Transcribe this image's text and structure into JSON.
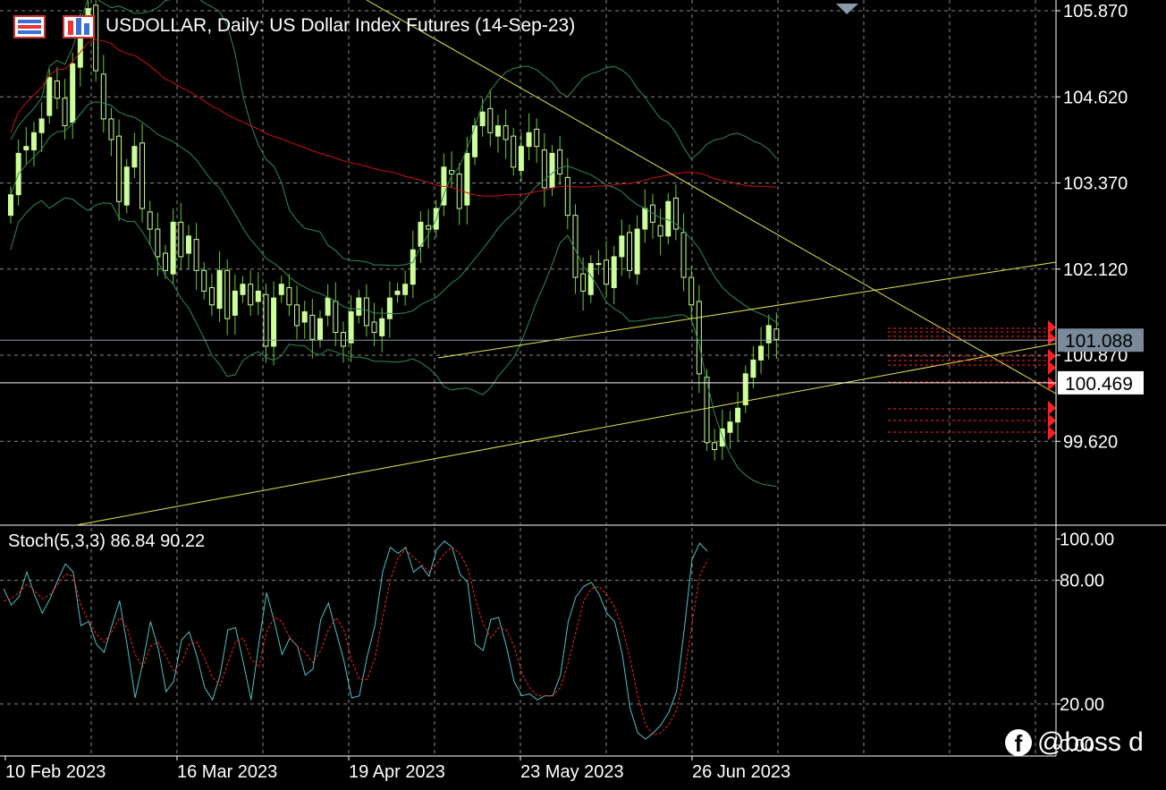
{
  "header": {
    "title": "USDOLLAR, Daily:  US Dollar Index Futures (14-Sep-23)"
  },
  "toolbar": {
    "icons": [
      "bars-chart-icon",
      "candles-chart-icon"
    ]
  },
  "indicator": {
    "label": "Stoch(5,3,3) 86.84 90.22",
    "colors": {
      "main": "#4fc3c3",
      "signal": "#ff2020"
    }
  },
  "watermark": {
    "icon": "facebook-icon",
    "text": "@boss d"
  },
  "colors": {
    "background": "#000000",
    "grid": "#8a8a8a",
    "bull_body": "#ccff99",
    "bear_body": "#000000",
    "wick": "#66cc33",
    "bollinger": "#2e8b57",
    "ma": "#cc1111",
    "trendline": "#e6e64c",
    "levels": "#ff2020"
  },
  "chart_data": [
    {
      "type": "candlestick",
      "title": "USDOLLAR, Daily:  US Dollar Index Futures (14-Sep-23)",
      "x_tick_labels": [
        "10 Feb 2023",
        "16 Mar 2023",
        "19 Apr 2023",
        "23 May 2023",
        "26 Jun 2023"
      ],
      "y_tick_labels": [
        "105.870",
        "104.620",
        "103.370",
        "102.120",
        "100.870",
        "99.620"
      ],
      "ylim": [
        98.22,
        105.95
      ],
      "y_markers": [
        {
          "label": "101.088",
          "value": 101.088,
          "style": "bid"
        },
        {
          "label": "100.469",
          "value": 100.469,
          "style": "horizontal-line"
        }
      ],
      "grid": true,
      "close": [
        103.2,
        103.8,
        103.9,
        104.1,
        104.3,
        104.9,
        104.6,
        104.2,
        105.1,
        105.6,
        105.9,
        105.0,
        104.3,
        104.0,
        103.1,
        103.6,
        103.9,
        103.0,
        102.7,
        102.3,
        102.1,
        102.8,
        102.3,
        102.6,
        102.1,
        101.8,
        101.6,
        102.1,
        101.4,
        101.8,
        101.9,
        101.6,
        101.8,
        101.0,
        101.7,
        101.9,
        101.6,
        101.3,
        101.5,
        101.1,
        101.4,
        101.7,
        101.2,
        101.0,
        101.5,
        101.7,
        101.3,
        101.2,
        101.4,
        101.7,
        101.8,
        101.9,
        102.4,
        102.8,
        102.7,
        103.0,
        103.6,
        103.5,
        103.0,
        103.8,
        104.2,
        104.4,
        104.1,
        104.2,
        104.0,
        103.6,
        103.9,
        104.1,
        103.9,
        103.3,
        103.8,
        103.5,
        102.9,
        102.0,
        101.8,
        102.2,
        102.2,
        101.9,
        102.3,
        102.6,
        102.1,
        102.7,
        103.0,
        102.8,
        102.6,
        103.1,
        102.7,
        102.0,
        101.6,
        100.6,
        99.6,
        99.5,
        99.8,
        99.9,
        100.1,
        100.6,
        100.8,
        101.0,
        101.3,
        101.1
      ]
    },
    {
      "type": "line",
      "title": "Stoch(5,3,3) 86.84 90.22",
      "y_tick_labels": [
        "100.00",
        "80.00",
        "20.00",
        "0.00"
      ],
      "ylim": [
        0,
        100
      ],
      "grid": true,
      "series": [
        {
          "name": "Stoch(5,3,3)",
          "values": [
            76,
            68,
            72,
            84,
            73,
            64,
            71,
            80,
            88,
            84,
            58,
            60,
            49,
            45,
            58,
            70,
            48,
            23,
            40,
            60,
            47,
            26,
            31,
            51,
            55,
            43,
            28,
            22,
            34,
            56,
            57,
            40,
            22,
            49,
            74,
            60,
            44,
            52,
            48,
            34,
            37,
            61,
            69,
            55,
            41,
            23,
            24,
            43,
            58,
            84,
            96,
            93,
            96,
            84,
            87,
            82,
            95,
            99,
            96,
            83,
            79,
            49,
            46,
            61,
            62,
            48,
            31,
            24,
            25,
            22,
            24,
            24,
            34,
            60,
            72,
            77,
            79,
            73,
            64,
            60,
            44,
            18,
            6,
            3,
            6,
            10,
            16,
            26,
            56,
            90,
            98,
            94
          ]
        },
        {
          "name": "signal",
          "values": [
            70,
            71,
            74,
            78,
            75,
            71,
            73,
            78,
            83,
            82,
            68,
            60,
            54,
            50,
            55,
            62,
            57,
            44,
            38,
            48,
            50,
            43,
            36,
            40,
            49,
            50,
            42,
            33,
            29,
            40,
            50,
            52,
            42,
            38,
            55,
            62,
            60,
            52,
            48,
            45,
            40,
            46,
            56,
            62,
            56,
            41,
            32,
            32,
            42,
            62,
            80,
            91,
            95,
            91,
            88,
            84,
            88,
            93,
            96,
            93,
            86,
            71,
            59,
            52,
            57,
            56,
            48,
            35,
            28,
            24,
            24,
            24,
            28,
            40,
            55,
            70,
            76,
            77,
            73,
            67,
            57,
            42,
            24,
            10,
            5,
            6,
            10,
            17,
            33,
            59,
            82,
            90
          ]
        }
      ]
    }
  ]
}
